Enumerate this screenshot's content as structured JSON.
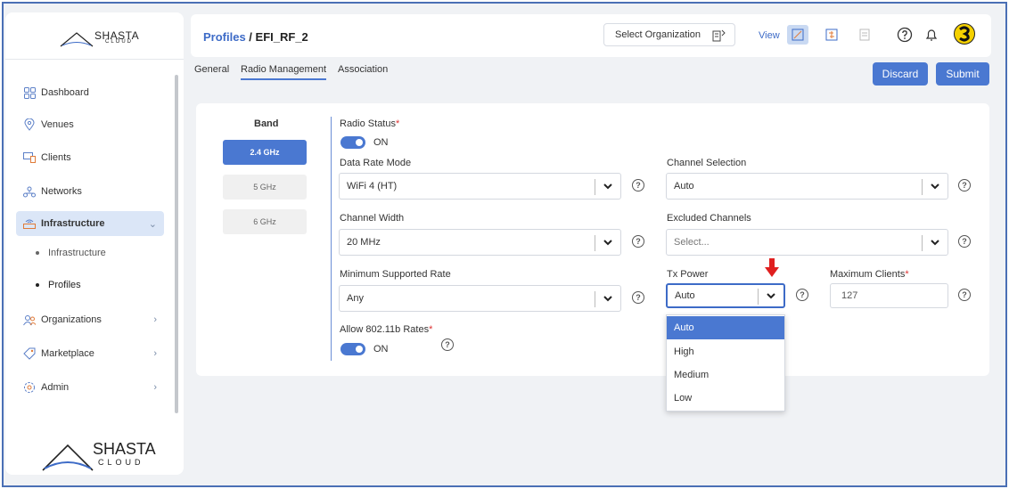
{
  "colors": {
    "accent": "#4a78d1",
    "link": "#3d6bc7",
    "required": "#dd3333",
    "annotation_arrow": "#e02020"
  },
  "brand": {
    "name": "SHASTA",
    "sub": "CLOUD"
  },
  "sidebar": {
    "items": [
      {
        "label": "Dashboard",
        "icon": "grid-icon"
      },
      {
        "label": "Venues",
        "icon": "location-pin-icon"
      },
      {
        "label": "Clients",
        "icon": "devices-icon"
      },
      {
        "label": "Networks",
        "icon": "network-icon"
      },
      {
        "label": "Infrastructure",
        "icon": "router-icon",
        "active": true,
        "expanded": true
      },
      {
        "label": "Organizations",
        "icon": "people-icon"
      },
      {
        "label": "Marketplace",
        "icon": "tag-icon"
      },
      {
        "label": "Admin",
        "icon": "gear-icon"
      }
    ],
    "sub_items": [
      "Infrastructure",
      "Profiles"
    ]
  },
  "header": {
    "breadcrumb_link": "Profiles",
    "breadcrumb_sep": " / ",
    "breadcrumb_current": "EFI_RF_2",
    "select_org": "Select Organization",
    "view_label": "View"
  },
  "tabs": [
    "General",
    "Radio Management",
    "Association"
  ],
  "active_tab": "Radio Management",
  "actions": {
    "discard": "Discard",
    "submit": "Submit"
  },
  "band": {
    "title": "Band",
    "options": [
      "2.4 GHz",
      "5 GHz",
      "6 GHz"
    ],
    "selected": "2.4 GHz"
  },
  "form": {
    "radio_status": {
      "label": "Radio Status",
      "req": "*",
      "value": "ON"
    },
    "data_rate_mode": {
      "label": "Data Rate Mode",
      "value": "WiFi 4 (HT)"
    },
    "channel_selection": {
      "label": "Channel Selection",
      "value": "Auto"
    },
    "channel_width": {
      "label": "Channel Width",
      "value": "20 MHz"
    },
    "excluded_channels": {
      "label": "Excluded Channels",
      "placeholder": "Select..."
    },
    "min_rate": {
      "label": "Minimum Supported Rate",
      "value": "Any"
    },
    "tx_power": {
      "label": "Tx Power",
      "value": "Auto"
    },
    "max_clients": {
      "label": "Maximum Clients",
      "req": "*",
      "value": "127"
    },
    "allow_11b": {
      "label": "Allow 802.11b Rates",
      "req": "*",
      "value": "ON"
    }
  },
  "tx_power_dropdown": {
    "options": [
      "Auto",
      "High",
      "Medium",
      "Low"
    ],
    "highlighted": "Auto"
  },
  "help_glyph": "?"
}
